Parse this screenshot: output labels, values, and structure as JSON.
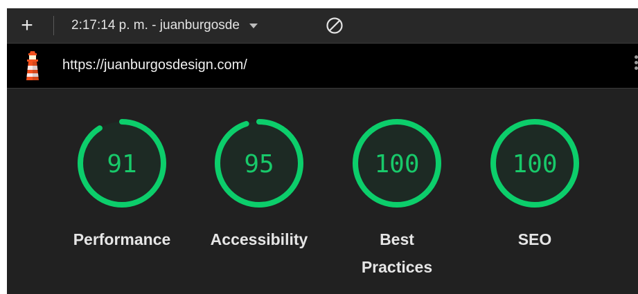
{
  "toolbar": {
    "add_icon": "plus-icon",
    "report_label": "2:17:14 p. m. - juanburgosde",
    "clear_icon": "block-icon"
  },
  "urlbar": {
    "logo_icon": "lighthouse-icon",
    "url": "https://juanburgosdesign.com/",
    "menu_icon": "kebab-menu-icon"
  },
  "colors": {
    "pass": "#0cce6b",
    "pass_text": "#18c96a",
    "gauge_bg": "#1d2a24"
  },
  "gauges": [
    {
      "label_lines": [
        "Performance"
      ],
      "score": "91"
    },
    {
      "label_lines": [
        "Accessibility"
      ],
      "score": "95"
    },
    {
      "label_lines": [
        "Best",
        "Practices"
      ],
      "score": "100"
    },
    {
      "label_lines": [
        "SEO"
      ],
      "score": "100"
    }
  ]
}
